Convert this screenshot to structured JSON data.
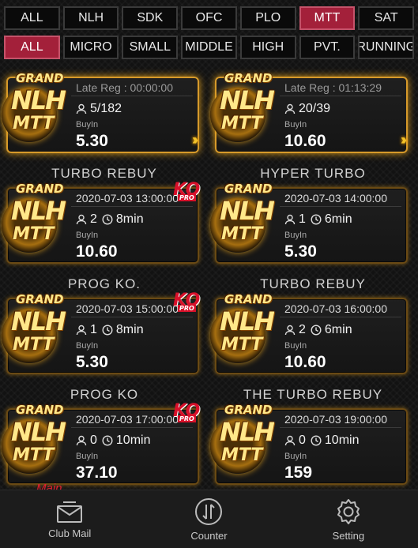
{
  "filters_row1": [
    {
      "label": "ALL",
      "active": false
    },
    {
      "label": "NLH",
      "active": false
    },
    {
      "label": "SDK",
      "active": false
    },
    {
      "label": "OFC",
      "active": false
    },
    {
      "label": "PLO",
      "active": false
    },
    {
      "label": "MTT",
      "active": true
    },
    {
      "label": "SAT",
      "active": false
    }
  ],
  "filters_row2": [
    {
      "label": "ALL",
      "active": true
    },
    {
      "label": "MICRO",
      "active": false
    },
    {
      "label": "SMALL",
      "active": false
    },
    {
      "label": "MIDDLE",
      "active": false
    },
    {
      "label": "HIGH",
      "active": false
    },
    {
      "label": "PVT.",
      "active": false
    },
    {
      "label": "RUNNING",
      "active": false
    }
  ],
  "logo_text": {
    "grand": "GRAND",
    "game": "NLH",
    "type": "MTT"
  },
  "ko_badge": {
    "ko": "KO",
    "pro": "PRO"
  },
  "buyin_label": "BuyIn",
  "tournaments": [
    {
      "title": "",
      "header": "Late Reg : 00:00:00",
      "late": true,
      "players": "5/182",
      "duration": "",
      "buyin": "5.30",
      "ko": false,
      "main": "",
      "chevron": true
    },
    {
      "title": "",
      "header": "Late Reg : 01:13:29",
      "late": true,
      "players": "20/39",
      "duration": "",
      "buyin": "10.60",
      "ko": false,
      "main": "",
      "chevron": true
    },
    {
      "title": "TURBO REBUY",
      "header": "2020-07-03 13:00:00",
      "late": false,
      "players": "2",
      "duration": "8min",
      "buyin": "10.60",
      "ko": true,
      "main": "",
      "chevron": false
    },
    {
      "title": "HYPER TURBO",
      "header": "2020-07-03 14:00:00",
      "late": false,
      "players": "1",
      "duration": "6min",
      "buyin": "5.30",
      "ko": false,
      "main": "",
      "chevron": false
    },
    {
      "title": "PROG KO.",
      "header": "2020-07-03 15:00:00",
      "late": false,
      "players": "1",
      "duration": "8min",
      "buyin": "5.30",
      "ko": true,
      "main": "",
      "chevron": false
    },
    {
      "title": "TURBO REBUY",
      "header": "2020-07-03 16:00:00",
      "late": false,
      "players": "2",
      "duration": "6min",
      "buyin": "10.60",
      "ko": false,
      "main": "",
      "chevron": false
    },
    {
      "title": "PROG KO",
      "header": "2020-07-03 17:00:00",
      "late": false,
      "players": "0",
      "duration": "10min",
      "buyin": "37.10",
      "ko": true,
      "main": "Main",
      "chevron": false
    },
    {
      "title": "THE TURBO REBUY",
      "header": "2020-07-03 19:00:00",
      "late": false,
      "players": "0",
      "duration": "10min",
      "buyin": "159",
      "ko": false,
      "main": "",
      "chevron": false
    }
  ],
  "bottom_nav": [
    {
      "label": "Club Mail",
      "icon": "mail-icon"
    },
    {
      "label": "Counter",
      "icon": "counter-icon"
    },
    {
      "label": "Setting",
      "icon": "gear-icon"
    }
  ]
}
